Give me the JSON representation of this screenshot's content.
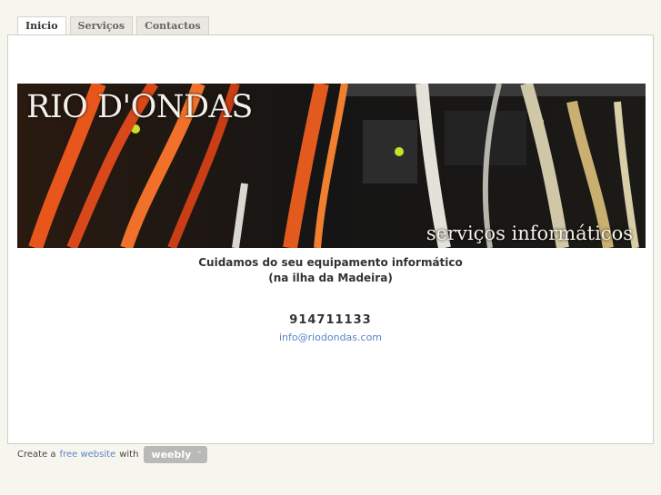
{
  "tabs": [
    {
      "label": "Inicio",
      "active": true
    },
    {
      "label": "Serviços",
      "active": false
    },
    {
      "label": "Contactos",
      "active": false
    }
  ],
  "banner": {
    "title": "RIO D'ONDAS",
    "subtitle": "serviços informáticos"
  },
  "main": {
    "tagline_line1": "Cuidamos do seu equipamento informático",
    "tagline_line2": "(na ilha da Madeira)",
    "phone": "914711133",
    "email": "info@riodondas.com"
  },
  "footer": {
    "prefix": "Create a",
    "link": "free website",
    "suffix": "with",
    "badge": "weebly",
    "badge_arrow": "^"
  }
}
